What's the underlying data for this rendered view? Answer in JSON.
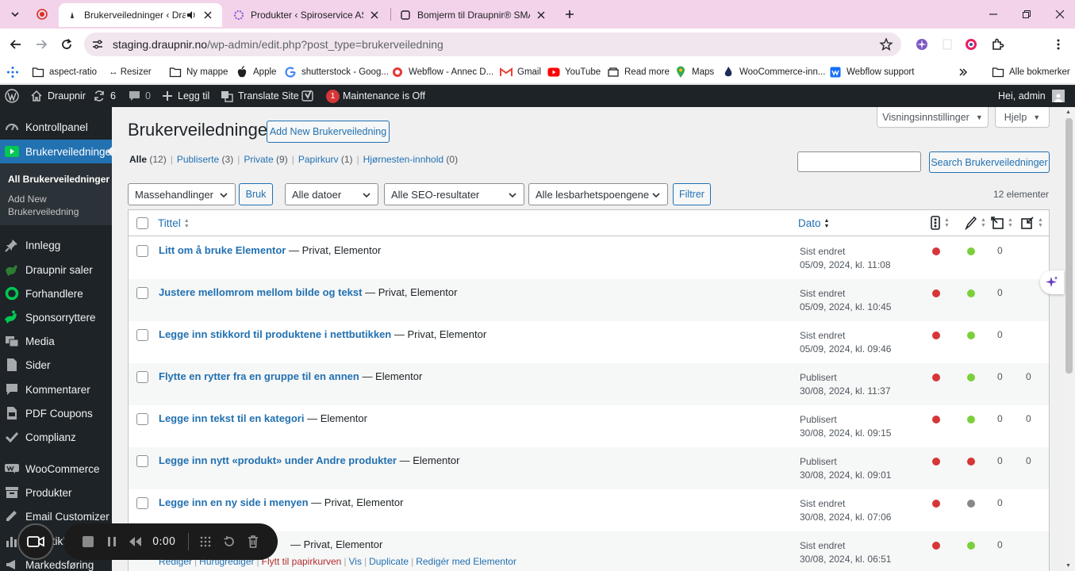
{
  "browser": {
    "tabs": [
      {
        "title": "Brukerveiledninger ‹ Draupnir",
        "active": true
      },
      {
        "title": "Produkter ‹ Spiroservice AS — W",
        "active": false
      },
      {
        "title": "Bomjerm til Draupnir® SMART",
        "active": false
      }
    ],
    "url_host": "staging.draupnir.no",
    "url_path": "/wp-admin/edit.php?post_type=brukerveiledning",
    "profile_initial": "A",
    "bookmarks": [
      {
        "label": "aspect-ratio",
        "icon": "folder-icon"
      },
      {
        "label": "↔ Resizer",
        "icon": "none"
      },
      {
        "label": "Ny mappe",
        "icon": "folder-icon"
      },
      {
        "label": "Apple",
        "icon": "apple-icon"
      },
      {
        "label": "shutterstock - Goog...",
        "icon": "google-icon"
      },
      {
        "label": "Webflow - Annec D...",
        "icon": "webflow-icon"
      },
      {
        "label": "Gmail",
        "icon": "gmail-icon"
      },
      {
        "label": "YouTube",
        "icon": "youtube-icon"
      },
      {
        "label": "Read more",
        "icon": "read-more-icon"
      },
      {
        "label": "Maps",
        "icon": "maps-icon"
      },
      {
        "label": "WooCommerce-inn...",
        "icon": "woocommerce-icon"
      },
      {
        "label": "Webflow support",
        "icon": "webflow-support-icon"
      },
      {
        "label": "Alle bokmerker",
        "icon": "folder-icon"
      }
    ]
  },
  "adminbar": {
    "site_name": "Draupnir",
    "updates_count": "6",
    "comments_count": "0",
    "new_label": "Legg til",
    "translate_label": "Translate Site",
    "yoast_badge": "1",
    "maintenance_label": "Maintenance is Off",
    "greeting": "Hei, admin"
  },
  "sidebar": {
    "items": [
      {
        "label": "Kontrollpanel",
        "icon": "dashboard-icon"
      },
      {
        "label": "Brukerveiledninger",
        "icon": "video-icon"
      },
      {
        "label": "Innlegg",
        "icon": "pin-icon"
      },
      {
        "label": "Draupnir saler",
        "icon": "horse-icon"
      },
      {
        "label": "Forhandlere",
        "icon": "ring-icon"
      },
      {
        "label": "Sponsorryttere",
        "icon": "rider-icon"
      },
      {
        "label": "Media",
        "icon": "media-icon"
      },
      {
        "label": "Sider",
        "icon": "page-icon"
      },
      {
        "label": "Kommentarer",
        "icon": "comment-icon"
      },
      {
        "label": "PDF Coupons",
        "icon": "pdf-icon"
      },
      {
        "label": "Complianz",
        "icon": "check-icon"
      },
      {
        "label": "WooCommerce",
        "icon": "woo-icon"
      },
      {
        "label": "Produkter",
        "icon": "archive-icon"
      },
      {
        "label": "Email Customizer",
        "icon": "email-icon"
      },
      {
        "label": "Analytikk",
        "icon": "chart-icon"
      },
      {
        "label": "Markedsføring",
        "icon": "megaphone-icon"
      }
    ],
    "submenu": {
      "all": "All Brukerveiledninger",
      "add_line1": "Add New",
      "add_line2": "Brukerveiledning"
    }
  },
  "page": {
    "title": "Brukerveiledninger",
    "add_new": "Add New Brukerveiledning",
    "screen_options": "Visningsinnstillinger",
    "help": "Hjelp",
    "views": [
      {
        "label": "Alle",
        "count": "(12)",
        "current": true
      },
      {
        "label": "Publiserte",
        "count": "(3)",
        "current": false
      },
      {
        "label": "Private",
        "count": "(9)",
        "current": false
      },
      {
        "label": "Papirkurv",
        "count": "(1)",
        "current": false
      },
      {
        "label": "Hjørnesten-innhold",
        "count": "(0)",
        "current": false
      }
    ],
    "search_button": "Search Brukerveiledninger",
    "bulk_actions": "Massehandlinger",
    "apply": "Bruk",
    "all_dates": "Alle datoer",
    "seo_filter": "Alle SEO-resultater",
    "readability_filter": "Alle lesbarhetspoengene",
    "filter_button": "Filtrer",
    "items_count": "12 elementer"
  },
  "table": {
    "col_title": "Tittel",
    "col_date": "Dato",
    "colors": {
      "red": "#d63638",
      "green": "#7ad03a",
      "gray": "#888888"
    },
    "rows": [
      {
        "title": "Litt om å bruke Elementor",
        "state": " — Privat, Elementor",
        "status": "Sist endret",
        "date": "05/09, 2024, kl. 11:08",
        "seo": "red",
        "read": "green",
        "links": "0",
        "linked": ""
      },
      {
        "title": "Justere mellomrom mellom bilde og tekst",
        "state": " — Privat, Elementor",
        "status": "Sist endret",
        "date": "05/09, 2024, kl. 10:45",
        "seo": "red",
        "read": "green",
        "links": "0",
        "linked": ""
      },
      {
        "title": "Legge inn stikkord til produktene i nettbutikken",
        "state": " — Privat, Elementor",
        "status": "Sist endret",
        "date": "05/09, 2024, kl. 09:46",
        "seo": "red",
        "read": "green",
        "links": "0",
        "linked": ""
      },
      {
        "title": "Flytte en rytter fra en gruppe til en annen",
        "state": " — Elementor",
        "status": "Publisert",
        "date": "30/08, 2024, kl. 11:37",
        "seo": "red",
        "read": "green",
        "links": "0",
        "linked": "0"
      },
      {
        "title": "Legge inn tekst til en kategori",
        "state": " — Elementor",
        "status": "Publisert",
        "date": "30/08, 2024, kl. 09:15",
        "seo": "red",
        "read": "green",
        "links": "0",
        "linked": "0"
      },
      {
        "title": "Legge inn nytt «produkt» under Andre produkter",
        "state": " — Elementor",
        "status": "Publisert",
        "date": "30/08, 2024, kl. 09:01",
        "seo": "red",
        "read": "red",
        "links": "0",
        "linked": "0"
      },
      {
        "title": "Legge inn en ny side i menyen",
        "state": " — Privat, Elementor",
        "status": "Sist endret",
        "date": "30/08, 2024, kl. 07:06",
        "seo": "red",
        "read": "gray",
        "links": "0",
        "linked": ""
      },
      {
        "title": "",
        "state": " — Privat, Elementor",
        "status": "Sist endret",
        "date": "30/08, 2024, kl. 06:51",
        "seo": "red",
        "read": "green",
        "links": "0",
        "linked": ""
      }
    ],
    "row_actions": [
      "Rediger",
      "Hurtigrediger",
      "Flytt til papirkurven",
      "Vis",
      "Duplicate",
      "Redigér med Elementor"
    ]
  },
  "recorder": {
    "time": "0:00"
  }
}
